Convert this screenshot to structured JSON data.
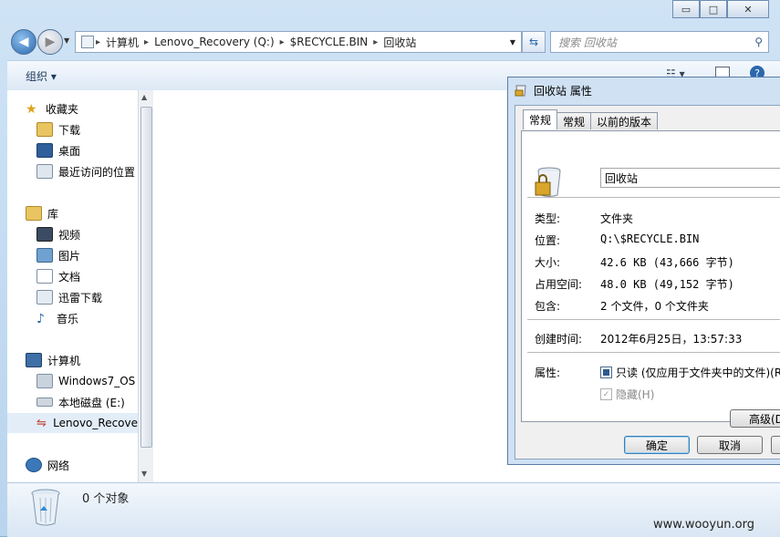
{
  "window": {
    "controls": {
      "minimize": "▭",
      "maximize": "□",
      "close": "✕"
    }
  },
  "address": {
    "crumbs": [
      "计算机",
      "Lenovo_Recovery (Q:)",
      "$RECYCLE.BIN",
      "回收站"
    ]
  },
  "search": {
    "placeholder": "搜索 回收站"
  },
  "toolbar": {
    "organize": "组织 ▾"
  },
  "nav": {
    "favorites": "收藏夹",
    "downloads": "下载",
    "desktop": "桌面",
    "recent": "最近访问的位置",
    "libraries": "库",
    "videos": "视频",
    "pictures": "图片",
    "documents": "文档",
    "thunder": "迅雷下载",
    "music": "音乐",
    "computer": "计算机",
    "drive_c": "Windows7_OS (",
    "drive_e": "本地磁盘 (E:)",
    "drive_q": "Lenovo_Recove",
    "network": "网络"
  },
  "details": {
    "count": "0 个对象"
  },
  "watermark": "www.wooyun.org",
  "dialog": {
    "title": "回收站 属性",
    "tabs": [
      "常规",
      "常规",
      "以前的版本"
    ],
    "name": "回收站",
    "rows": {
      "type_label": "类型:",
      "type_value": "文件夹",
      "location_label": "位置:",
      "location_value": "Q:\\$RECYCLE.BIN",
      "size_label": "大小:",
      "size_value": "42.6 KB (43,666 字节)",
      "disk_label": "占用空间:",
      "disk_value": "48.0 KB (49,152 字节)",
      "contains_label": "包含:",
      "contains_value": "2 个文件，0 个文件夹",
      "created_label": "创建时间:",
      "created_value": "2012年6月25日，13:57:33",
      "attr_label": "属性:"
    },
    "readonly": "只读 (仅应用于文件夹中的文件)(R",
    "hidden": "隐藏(H)",
    "advanced": "高级(D",
    "ok": "确定",
    "cancel": "取消"
  },
  "colors": {
    "accent": "#2b67ad",
    "selection": "#e2edf8"
  }
}
